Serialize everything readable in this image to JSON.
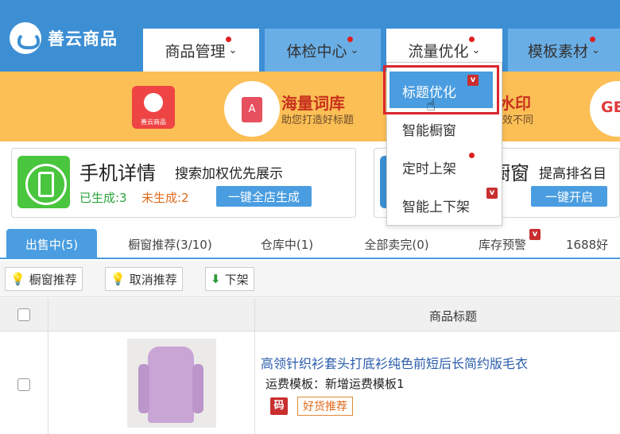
{
  "app": {
    "logo_text": "善云商品"
  },
  "nav": {
    "tabs": [
      {
        "label": "商品管理",
        "chevron": "⌄"
      },
      {
        "label": "体检中心",
        "chevron": "⌄"
      },
      {
        "label": "流量优化",
        "chevron": "⌄"
      },
      {
        "label": "模板素材",
        "chevron": "⌄"
      }
    ]
  },
  "dropdown": {
    "items": [
      "标题优化",
      "智能橱窗",
      "定时上架",
      "智能上下架"
    ],
    "badge": "v"
  },
  "banner": {
    "logo_small": "善云商品",
    "book_glyph": "A",
    "title1": "海量词库",
    "sub1": "助您打造好标题",
    "title2": "水印",
    "sub2": "效不同",
    "right_text": "GE"
  },
  "cards": {
    "left": {
      "title": "手机详情",
      "subtitle": "搜索加权优先展示",
      "generated": "已生成:3",
      "not_generated": "未生成:2",
      "button": "一键全店生成"
    },
    "right": {
      "title": "橱窗",
      "subtitle": "提高排名目",
      "button": "一键开启"
    }
  },
  "subtabs": [
    {
      "label": "出售中(5)"
    },
    {
      "label": "橱窗推荐(3/10)"
    },
    {
      "label": "仓库中(1)"
    },
    {
      "label": "全部卖完(0)"
    },
    {
      "label": "库存预警"
    },
    {
      "label": "1688好"
    }
  ],
  "toolbar": {
    "buttons": [
      {
        "label": "橱窗推荐",
        "icon": "bulb-icon"
      },
      {
        "label": "取消推荐",
        "icon": "bulb-off-icon"
      },
      {
        "label": "下架",
        "icon": "arrow-down-icon"
      }
    ]
  },
  "table": {
    "header_title": "商品标题",
    "rows": [
      {
        "title": "高领针织衫套头打底衫纯色前短后长简约版毛衣",
        "template": "运费模板：新增运费模板1",
        "badge": "码",
        "tag": "好货推荐"
      }
    ]
  },
  "colors": {
    "brand": "#3d8fd4",
    "banner": "#fbbf55",
    "highlight": "#d9262e"
  }
}
